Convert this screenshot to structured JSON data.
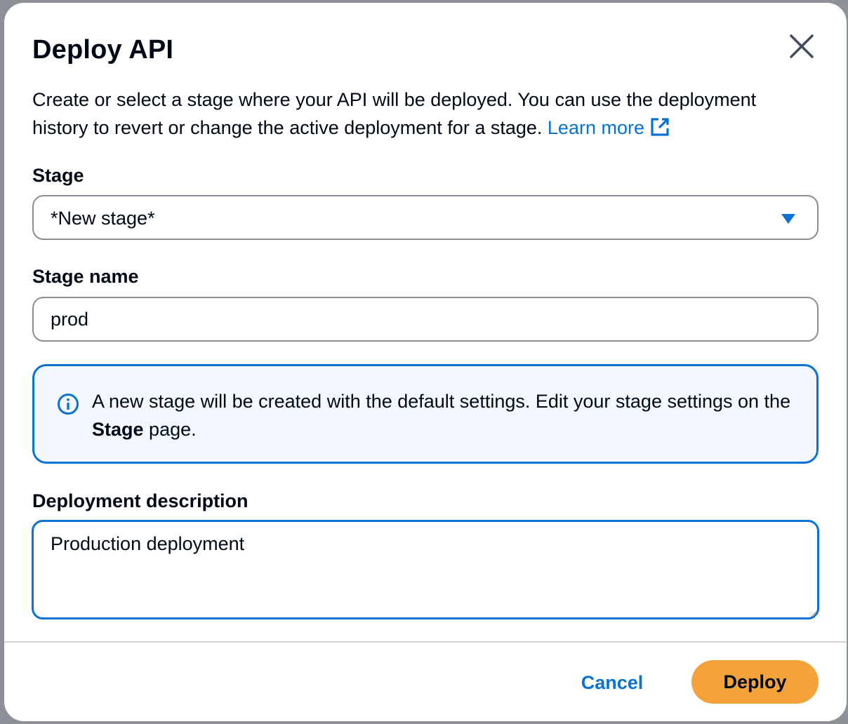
{
  "modal": {
    "title": "Deploy API",
    "description": "Create or select a stage where your API will be deployed. You can use the deployment history to revert or change the active deployment for a stage.",
    "learn_more": "Learn more"
  },
  "stage": {
    "label": "Stage",
    "selected_value": "*New stage*"
  },
  "stage_name": {
    "label": "Stage name",
    "value": "prod"
  },
  "info_alert": {
    "text_before": "A new stage will be created with the default settings. Edit your stage settings on the",
    "bold_text": "Stage",
    "text_after": "page."
  },
  "deployment_description": {
    "label": "Deployment description",
    "value": "Production deployment"
  },
  "footer": {
    "cancel_label": "Cancel",
    "deploy_label": "Deploy"
  },
  "colors": {
    "accent": "#0972d3",
    "primary_button": "#f3a33a",
    "info_background": "#f2f8fd"
  }
}
